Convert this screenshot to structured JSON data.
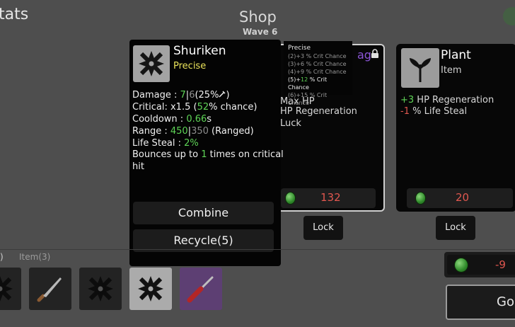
{
  "header": {
    "stats_title": "tats",
    "shop_title": "Shop",
    "wave": "Wave 6"
  },
  "detail_panel": {
    "name": "Shuriken",
    "tier": "Precise",
    "damage_label": "Damage : ",
    "damage_value": "7",
    "damage_sep": "|",
    "damage_base": "6",
    "damage_scaling": "(25%",
    "critical_label": "Critical: x1.5 (",
    "critical_value": "52",
    "critical_suffix": "% chance)",
    "cooldown_label": "Cooldown : ",
    "cooldown_value": "0.66",
    "cooldown_unit": "s",
    "range_label": "Range : ",
    "range_value": "450",
    "range_sep": "|",
    "range_base": "350",
    "range_type": " (Ranged)",
    "lifesteal_label": "Life Steal : ",
    "lifesteal_value": "2%",
    "bounce_prefix": "Bounces up to ",
    "bounce_value": "1",
    "bounce_suffix": " times on critical",
    "bounce_suffix2": "hit",
    "combine_button": "Combine",
    "recycle_button": "Recycle(5)"
  },
  "precise_tooltip": {
    "header": "Precise",
    "lines": [
      "(2)+3 % Crit Chance",
      "(3)+6 % Crit Chance",
      "(4)+9 % Crit Chance",
      "(5)+12 % Crit Chance",
      "(6)+15 % Crit Chance"
    ],
    "highlight_count": "(5)+",
    "highlight_value": "12",
    "highlight_suffix": " % Crit Chance"
  },
  "shop_cards": [
    {
      "partial_title": "ag",
      "line1": "Max HP",
      "line2": "HP Regeneration",
      "line3": "Luck",
      "price": "132",
      "lock": "Lock"
    },
    {
      "name": "Plant",
      "type": "Item",
      "stat1_value": "+3",
      "stat1_label": " HP Regeneration",
      "stat2_value": "-1",
      "stat2_label": " % Life Steal",
      "price": "20",
      "lock": "Lock"
    }
  ],
  "bottom": {
    "tab_weapons": ")",
    "tab_items": "Item(3)",
    "money": "-9",
    "go_button": "Go"
  },
  "colors": {
    "background": "#4e4e4e",
    "positive": "#5ed456",
    "negative": "#e0574f",
    "tier_yellow": "#e9e25a",
    "rare_purple": "#8b55d6"
  }
}
